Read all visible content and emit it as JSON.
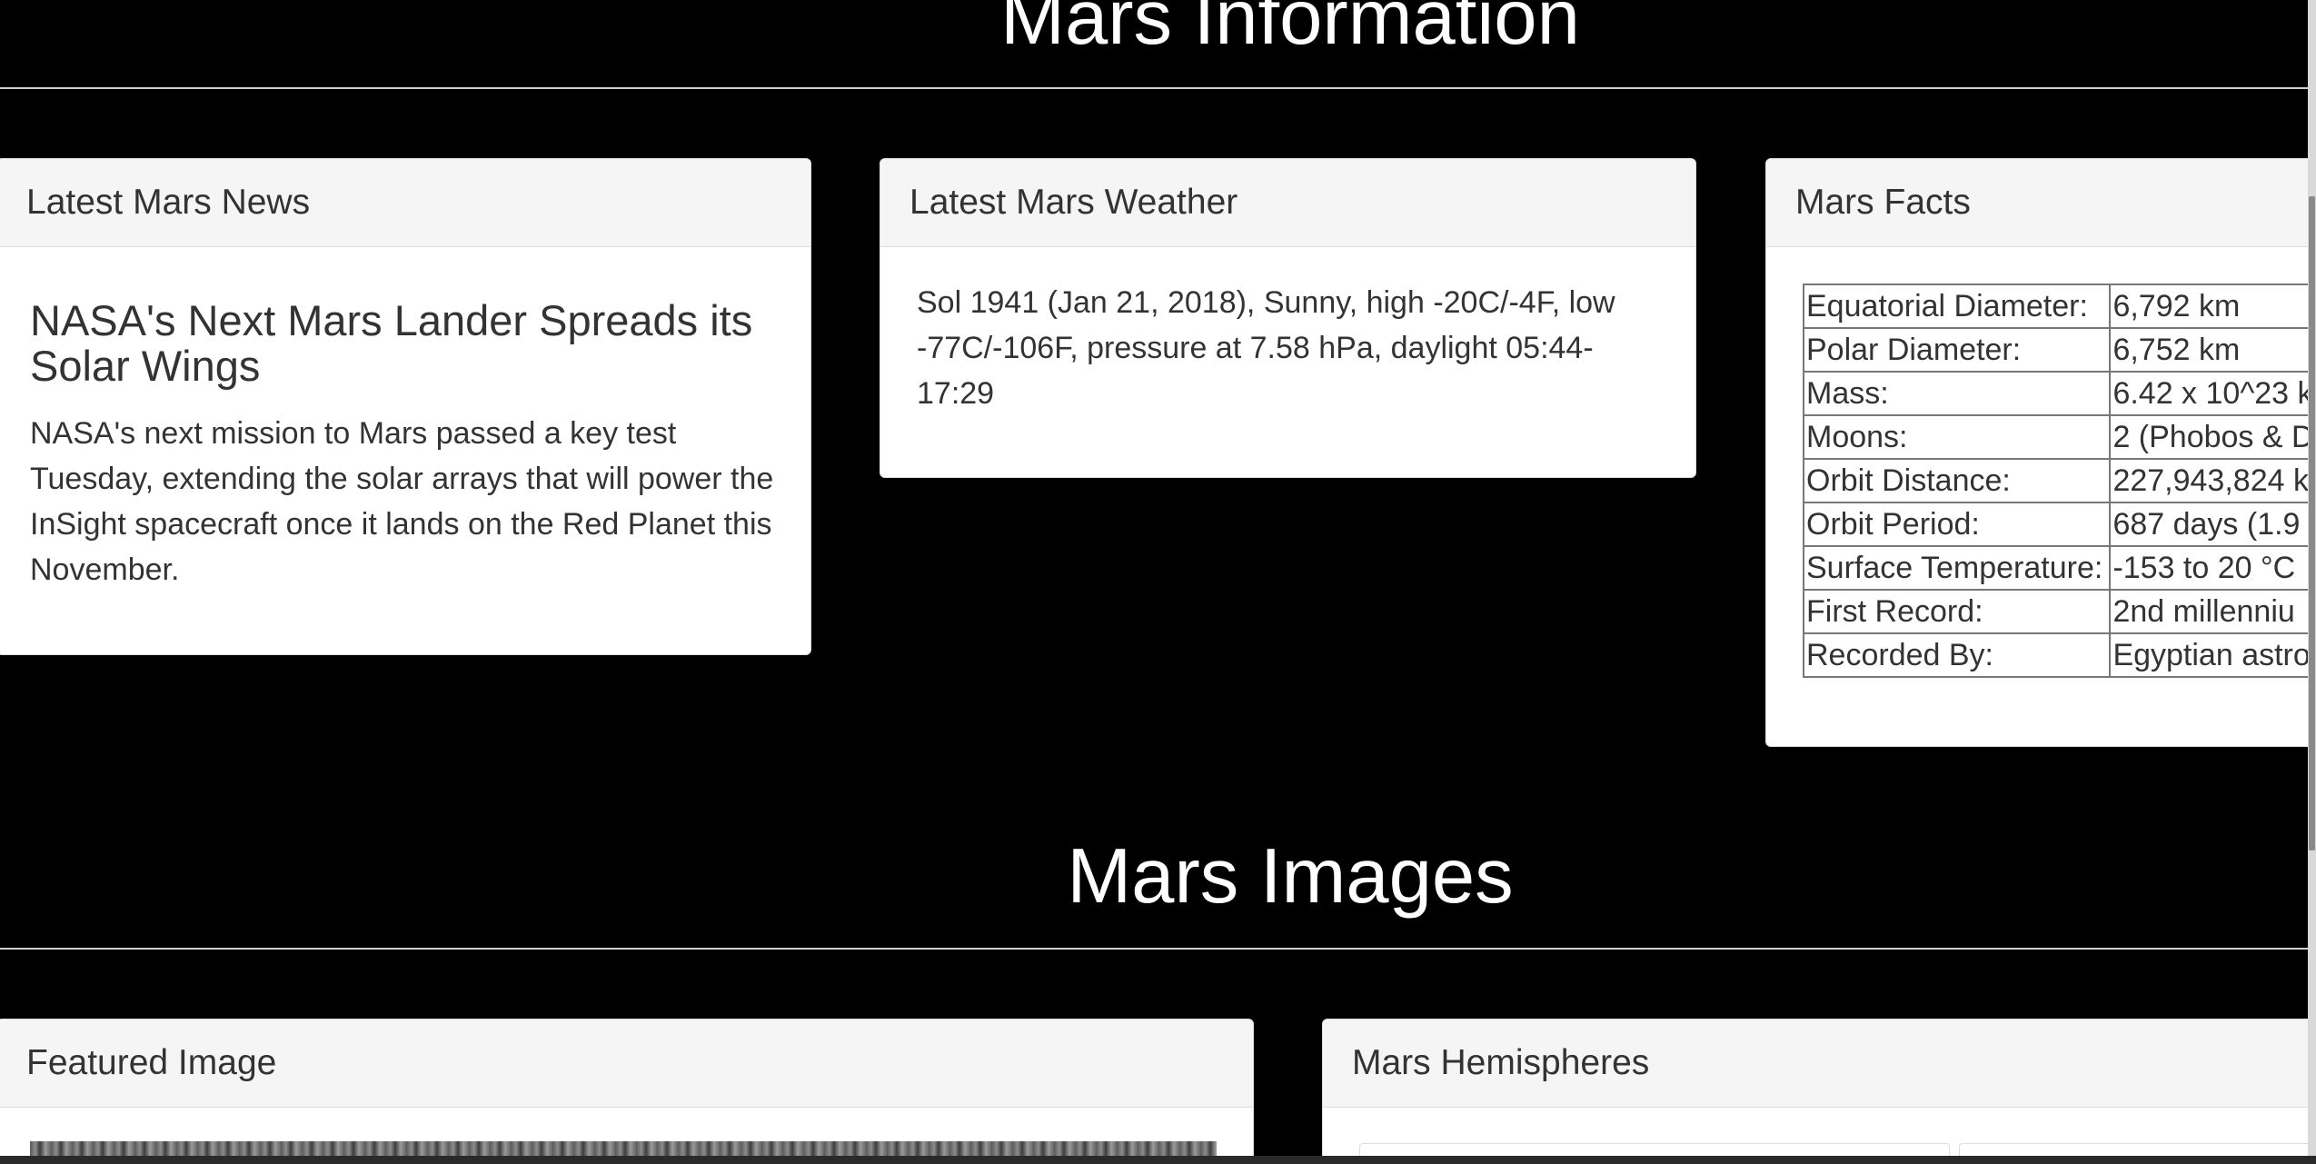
{
  "sections": {
    "info_title": "Mars Information",
    "images_title": "Mars Images"
  },
  "news": {
    "heading": "Latest Mars News",
    "title": "NASA's Next Mars Lander Spreads its Solar Wings",
    "body": "NASA's next mission to Mars passed a key test Tuesday, extending the solar arrays that will power the InSight spacecraft once it lands on the Red Planet this November."
  },
  "weather": {
    "heading": "Latest Mars Weather",
    "text": "Sol 1941 (Jan 21, 2018), Sunny, high -20C/-4F, low -77C/-106F, pressure at 7.58 hPa, daylight 05:44-17:29"
  },
  "facts": {
    "heading": "Mars Facts",
    "rows": [
      {
        "label": "Equatorial Diameter:",
        "value": "6,792 km"
      },
      {
        "label": "Polar Diameter:",
        "value": "6,752 km"
      },
      {
        "label": "Mass:",
        "value": "6.42 x 10^23 k"
      },
      {
        "label": "Moons:",
        "value": "2 (Phobos & D"
      },
      {
        "label": "Orbit Distance:",
        "value": "227,943,824 k"
      },
      {
        "label": "Orbit Period:",
        "value": "687 days (1.9"
      },
      {
        "label": "Surface Temperature:",
        "value": "-153 to 20 °C"
      },
      {
        "label": "First Record:",
        "value": "2nd millenniu"
      },
      {
        "label": "Recorded By:",
        "value": "Egyptian astro"
      }
    ]
  },
  "featured": {
    "heading": "Featured Image"
  },
  "hemispheres": {
    "heading": "Mars Hemispheres"
  },
  "colors": {
    "page_background": "#000000",
    "panel_background": "#ffffff",
    "panel_heading_background": "#f5f5f5",
    "title_text": "#ffffff"
  }
}
